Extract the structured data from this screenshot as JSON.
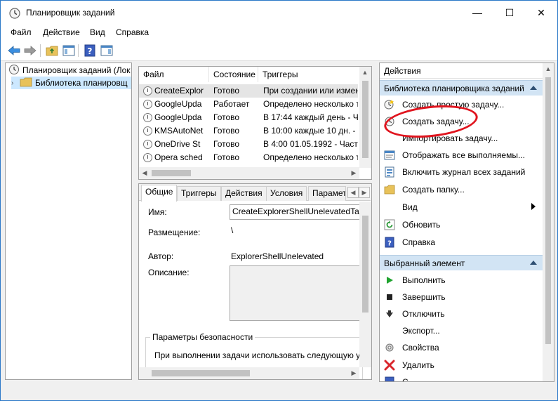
{
  "window": {
    "title": "Планировщик заданий"
  },
  "window_controls": {
    "minimize": "—",
    "maximize": "☐",
    "close": "✕"
  },
  "menu": [
    "Файл",
    "Действие",
    "Вид",
    "Справка"
  ],
  "tree": {
    "root": "Планировщик заданий (Лок",
    "child": "Библиотека планировщ"
  },
  "tasks": {
    "columns": [
      "Файл",
      "Состояние",
      "Триггеры"
    ],
    "rows": [
      {
        "name": "CreateExplor",
        "state": "Готово",
        "trigger": "При создании или измен"
      },
      {
        "name": "GoogleUpda",
        "state": "Работает",
        "trigger": "Определено несколько т"
      },
      {
        "name": "GoogleUpda",
        "state": "Готово",
        "trigger": "В 17:44 каждый день - Ча"
      },
      {
        "name": "KMSAutoNet",
        "state": "Готово",
        "trigger": "В 10:00 каждые 10 дн. - Ча"
      },
      {
        "name": "OneDrive St",
        "state": "Готово",
        "trigger": "В 4:00 01.05.1992 - Частот"
      },
      {
        "name": "Opera sched",
        "state": "Готово",
        "trigger": "Определено несколько т"
      }
    ]
  },
  "details": {
    "tabs": [
      "Общие",
      "Триггеры",
      "Действия",
      "Условия",
      "Парамет"
    ],
    "name_label": "Имя:",
    "name_value": "CreateExplorerShellUnelevatedTask",
    "location_label": "Размещение:",
    "location_value": "\\",
    "author_label": "Автор:",
    "author_value": "ExplorerShellUnelevated",
    "description_label": "Описание:",
    "security_group": "Параметры безопасности",
    "security_text": "При выполнении задачи использовать следующую у"
  },
  "actions": {
    "header": "Действия",
    "section1": "Библиотека планировщика заданий",
    "items1": [
      {
        "label": "Создать простую задачу...",
        "icon": "wizard-icon"
      },
      {
        "label": "Создать задачу...",
        "icon": "create-task-icon"
      },
      {
        "label": "Импортировать задачу...",
        "icon": "import-icon"
      },
      {
        "label": "Отображать все выполняемы...",
        "icon": "running-tasks-icon"
      },
      {
        "label": "Включить журнал всех заданий",
        "icon": "log-icon"
      },
      {
        "label": "Создать папку...",
        "icon": "folder-icon"
      },
      {
        "label": "Вид",
        "icon": "",
        "submenu": true
      },
      {
        "label": "Обновить",
        "icon": "refresh-icon"
      },
      {
        "label": "Справка",
        "icon": "help-icon"
      }
    ],
    "section2": "Выбранный элемент",
    "items2": [
      {
        "label": "Выполнить",
        "icon": "run-icon"
      },
      {
        "label": "Завершить",
        "icon": "stop-icon"
      },
      {
        "label": "Отключить",
        "icon": "disable-icon"
      },
      {
        "label": "Экспорт...",
        "icon": ""
      },
      {
        "label": "Свойства",
        "icon": "properties-icon"
      },
      {
        "label": "Удалить",
        "icon": "delete-icon"
      },
      {
        "label": "С",
        "icon": "help-icon"
      }
    ]
  },
  "colors": {
    "section_bg": "#d2e4f4",
    "highlight_circle": "#e0141e",
    "window_border": "#2a78c8"
  }
}
